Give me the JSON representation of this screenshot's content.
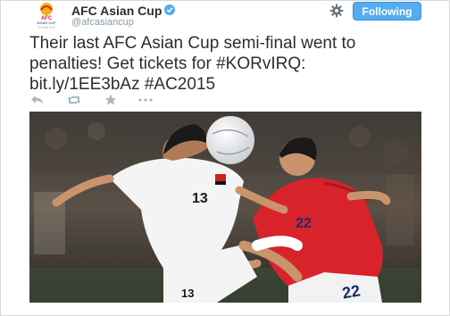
{
  "account": {
    "name": "AFC Asian Cup",
    "handle": "@afcasiancup",
    "verified": true,
    "logo_text": [
      "AFC",
      "ASIAN CUP",
      "Australia 2015"
    ]
  },
  "follow_button": {
    "label": "Following"
  },
  "tweet": {
    "lines": [
      "Their last AFC Asian Cup semi-final went to",
      "penalties! Get tickets for #KORvIRQ:",
      "bit.ly/1EE3bAz #AC2015"
    ]
  },
  "actions": {
    "icons": [
      "reply-icon",
      "retweet-icon",
      "favorite-icon",
      "more-icon"
    ]
  },
  "photo": {
    "player_left_number": "13",
    "player_right_number": "22",
    "left_kit_color": "#f4f4f4",
    "right_kit_color": "#d8232a"
  },
  "colors": {
    "accent": "#55acee",
    "text": "#292f33",
    "muted": "#8899a6"
  }
}
